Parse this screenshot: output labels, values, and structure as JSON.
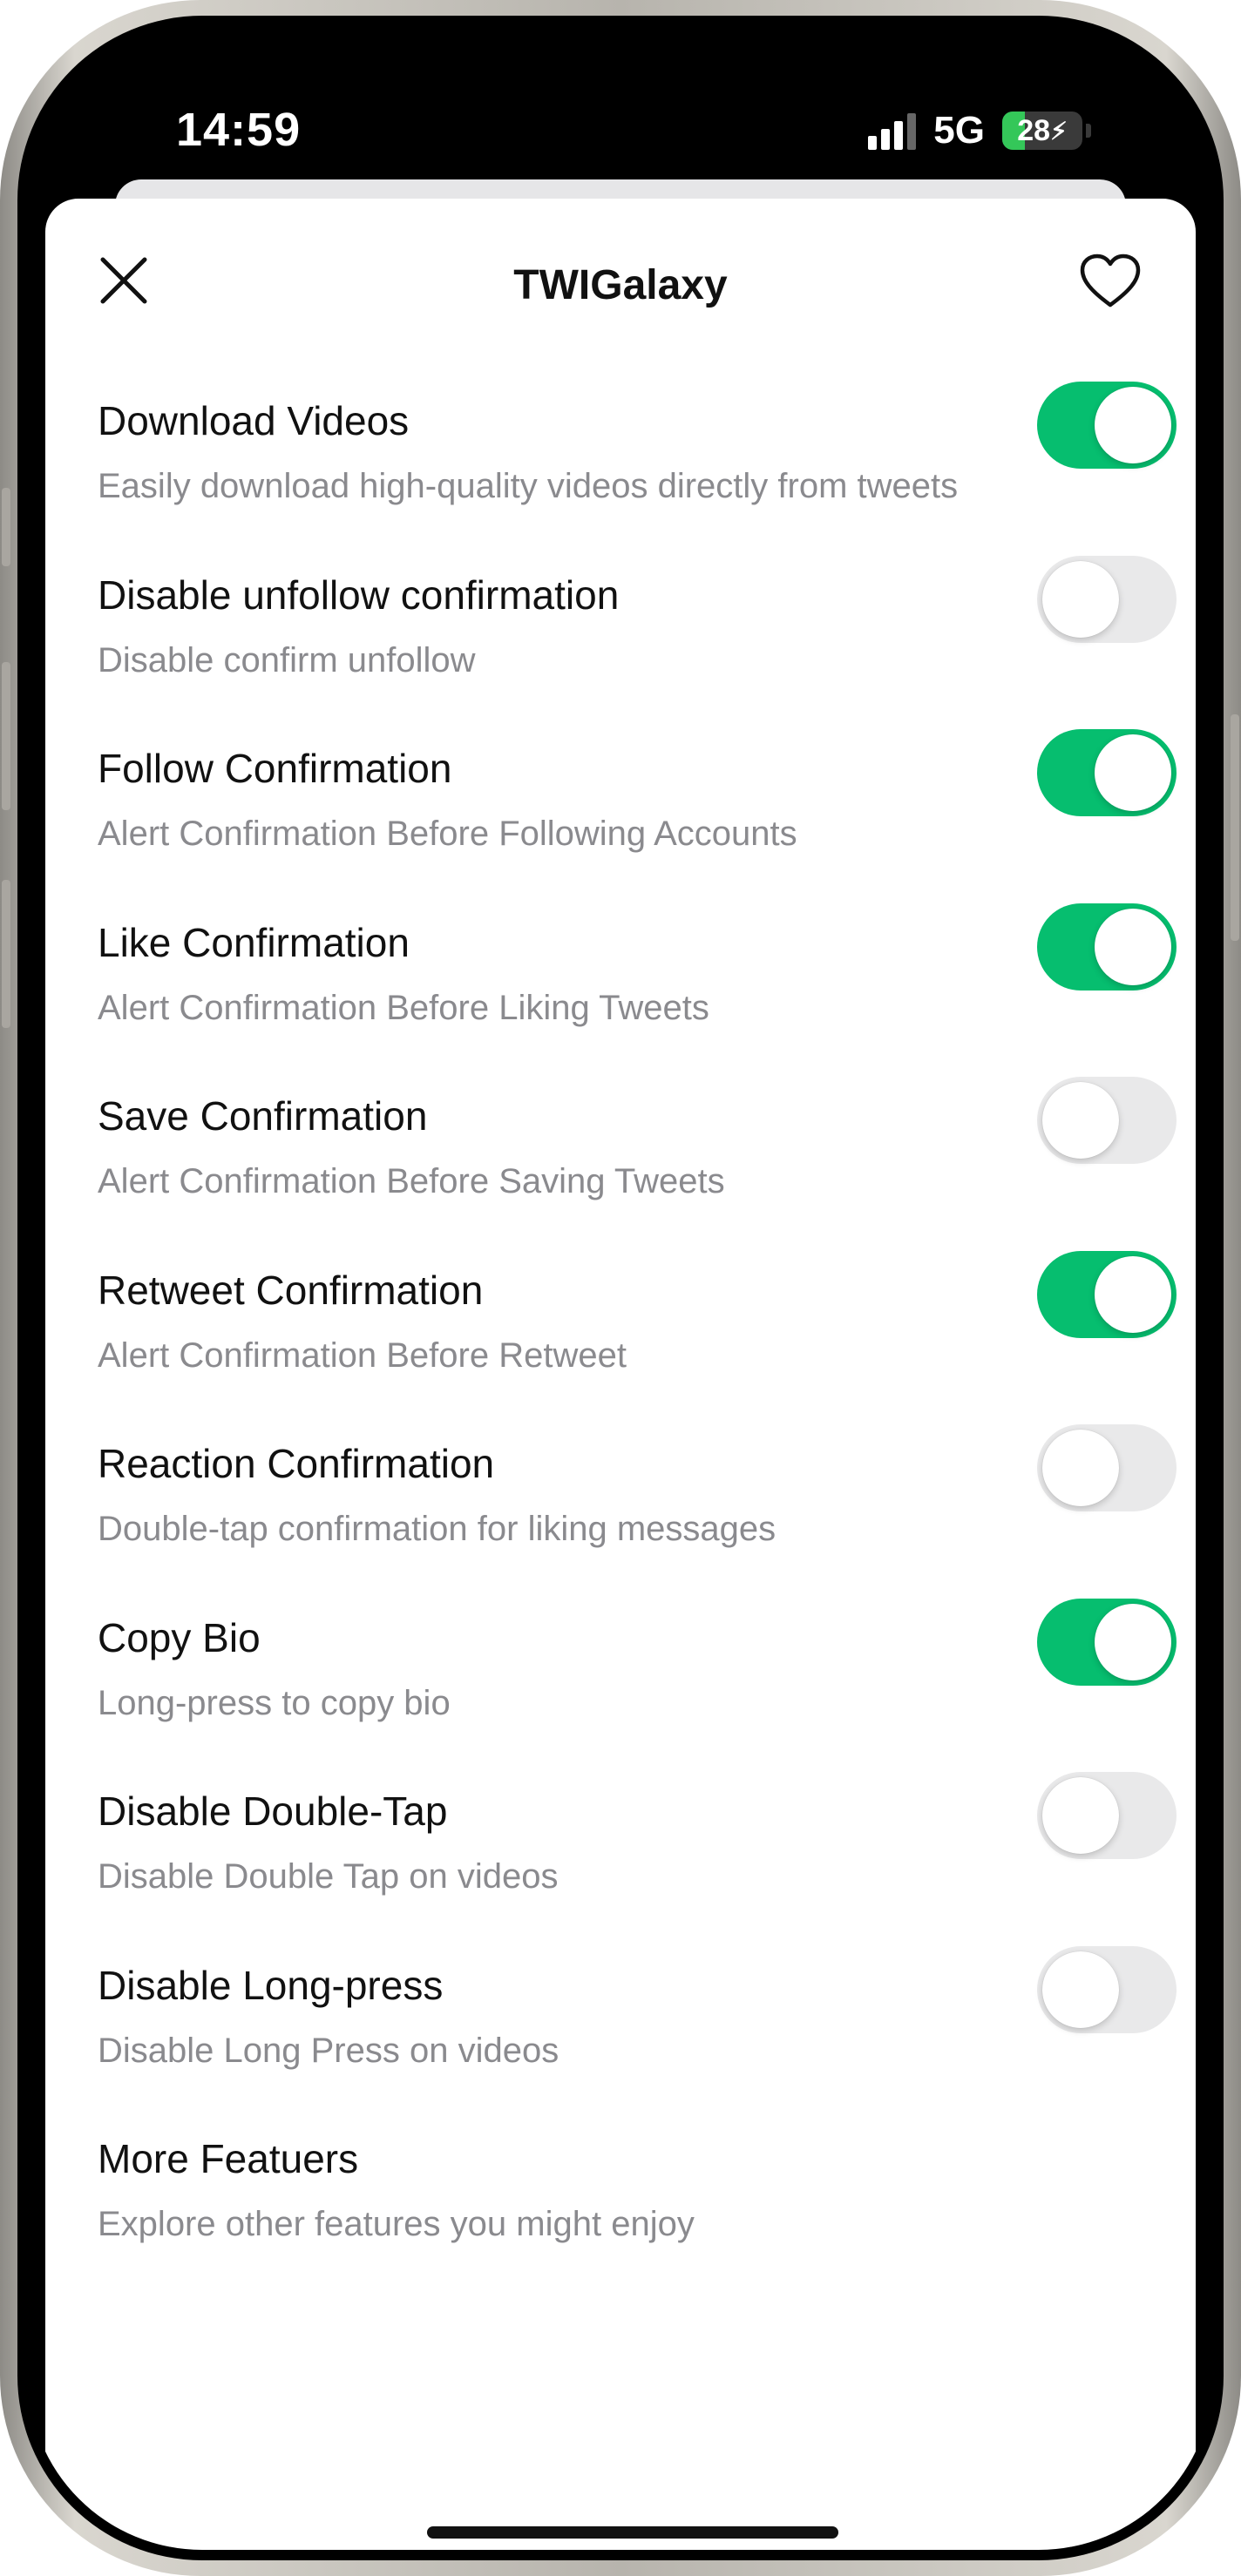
{
  "status_bar": {
    "time": "14:59",
    "network": "5G",
    "battery": "28",
    "battery_level_percent": 28,
    "signal_bars": 3,
    "signal_total": 4
  },
  "header": {
    "title": "TWIGalaxy",
    "close_icon": "close-icon",
    "favorite_icon": "heart-icon"
  },
  "colors": {
    "accent_green": "#06be6f",
    "toggle_off": "#e9e9ea",
    "subtitle_gray": "#8a8a8e"
  },
  "settings": [
    {
      "title": "Download Videos",
      "subtitle": "Easily download high-quality videos directly from tweets",
      "enabled": true
    },
    {
      "title": "Disable unfollow confirmation",
      "subtitle": "Disable confirm unfollow",
      "enabled": false
    },
    {
      "title": "Follow Confirmation",
      "subtitle": "Alert Confirmation Before Following Accounts",
      "enabled": true
    },
    {
      "title": "Like Confirmation",
      "subtitle": "Alert Confirmation Before Liking Tweets",
      "enabled": true
    },
    {
      "title": "Save Confirmation",
      "subtitle": "Alert Confirmation Before Saving Tweets",
      "enabled": false
    },
    {
      "title": "Retweet Confirmation",
      "subtitle": "Alert Confirmation Before Retweet",
      "enabled": true
    },
    {
      "title": "Reaction Confirmation",
      "subtitle": "Double-tap confirmation for liking messages",
      "enabled": false
    },
    {
      "title": "Copy Bio",
      "subtitle": "Long-press to copy bio",
      "enabled": true
    },
    {
      "title": "Disable Double-Tap",
      "subtitle": "Disable Double Tap on videos",
      "enabled": false
    },
    {
      "title": "Disable Long-press",
      "subtitle": "Disable Long Press on videos",
      "enabled": false
    }
  ],
  "more": {
    "title": "More Featuers",
    "subtitle": "Explore other features you might enjoy"
  }
}
